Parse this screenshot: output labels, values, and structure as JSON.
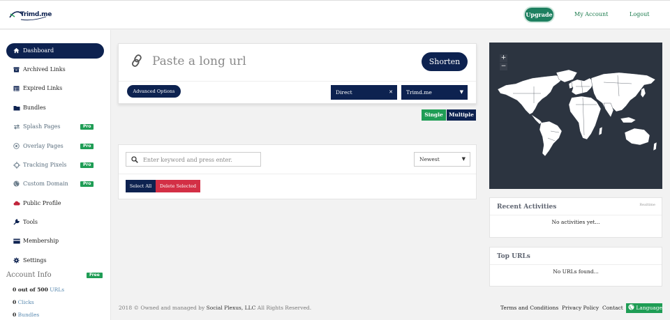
{
  "header": {
    "logo_text": "Trimd.me",
    "upgrade_label": "Upgrade",
    "my_account_label": "My Account",
    "logout_label": "Logout"
  },
  "sidebar": {
    "items": [
      {
        "label": "Dashboard",
        "icon": "home-icon",
        "active": true
      },
      {
        "label": "Archived Links",
        "icon": "archive-icon"
      },
      {
        "label": "Expired Links",
        "icon": "table-icon"
      },
      {
        "label": "Bundles",
        "icon": "folder-icon"
      },
      {
        "label": "Splash Pages",
        "icon": "exchange-icon",
        "badge": "Pro"
      },
      {
        "label": "Overlay Pages",
        "icon": "target-icon",
        "badge": "Pro"
      },
      {
        "label": "Tracking Pixels",
        "icon": "crosshair-icon",
        "badge": "Pro"
      },
      {
        "label": "Custom Domain",
        "icon": "globe-icon",
        "badge": "Pro"
      },
      {
        "label": "Public Profile",
        "icon": "cloud-icon"
      },
      {
        "label": "Tools",
        "icon": "wrench-icon"
      },
      {
        "label": "Membership",
        "icon": "credit-card-icon"
      },
      {
        "label": "Settings",
        "icon": "gear-icon"
      }
    ]
  },
  "account_info": {
    "title": "Account Info",
    "plan_badge": "Free",
    "urls_count": "0 out of 500",
    "urls_label": "URLs",
    "clicks_count": "0",
    "clicks_label": "Clicks",
    "bundles_count": "0",
    "bundles_label": "Bundles"
  },
  "shortener": {
    "placeholder": "Paste a long url",
    "shorten_label": "Shorten",
    "advanced_label": "Advanced Options",
    "redirect_select": "Direct",
    "domain_select": "Trimd.me",
    "mode_single": "Single",
    "mode_multiple": "Multiple"
  },
  "links_list": {
    "search_placeholder": "Enter keyword and press enter.",
    "sort_value": "Newest",
    "select_all_label": "Select All",
    "delete_selected_label": "Delete Selected"
  },
  "map": {
    "zoom_in": "+",
    "zoom_out": "−"
  },
  "recent_activities": {
    "title": "Recent Activities",
    "realtime_label": "Realtime",
    "empty_text": "No activities yet..."
  },
  "top_urls": {
    "title": "Top URLs",
    "empty_text": "No URLs found..."
  },
  "footer": {
    "copyright_prefix": "2018 © Owned and managed by",
    "company": "Social Plexus, LLC",
    "rights": "All Rights Reserved.",
    "terms": "Terms and Conditions",
    "privacy": "Privacy Policy",
    "contact": "Contact",
    "language": "Language"
  },
  "colors": {
    "navy": "#0d2250",
    "green": "#1f9d55",
    "red": "#d32f45",
    "map_bg": "#2c3440"
  }
}
